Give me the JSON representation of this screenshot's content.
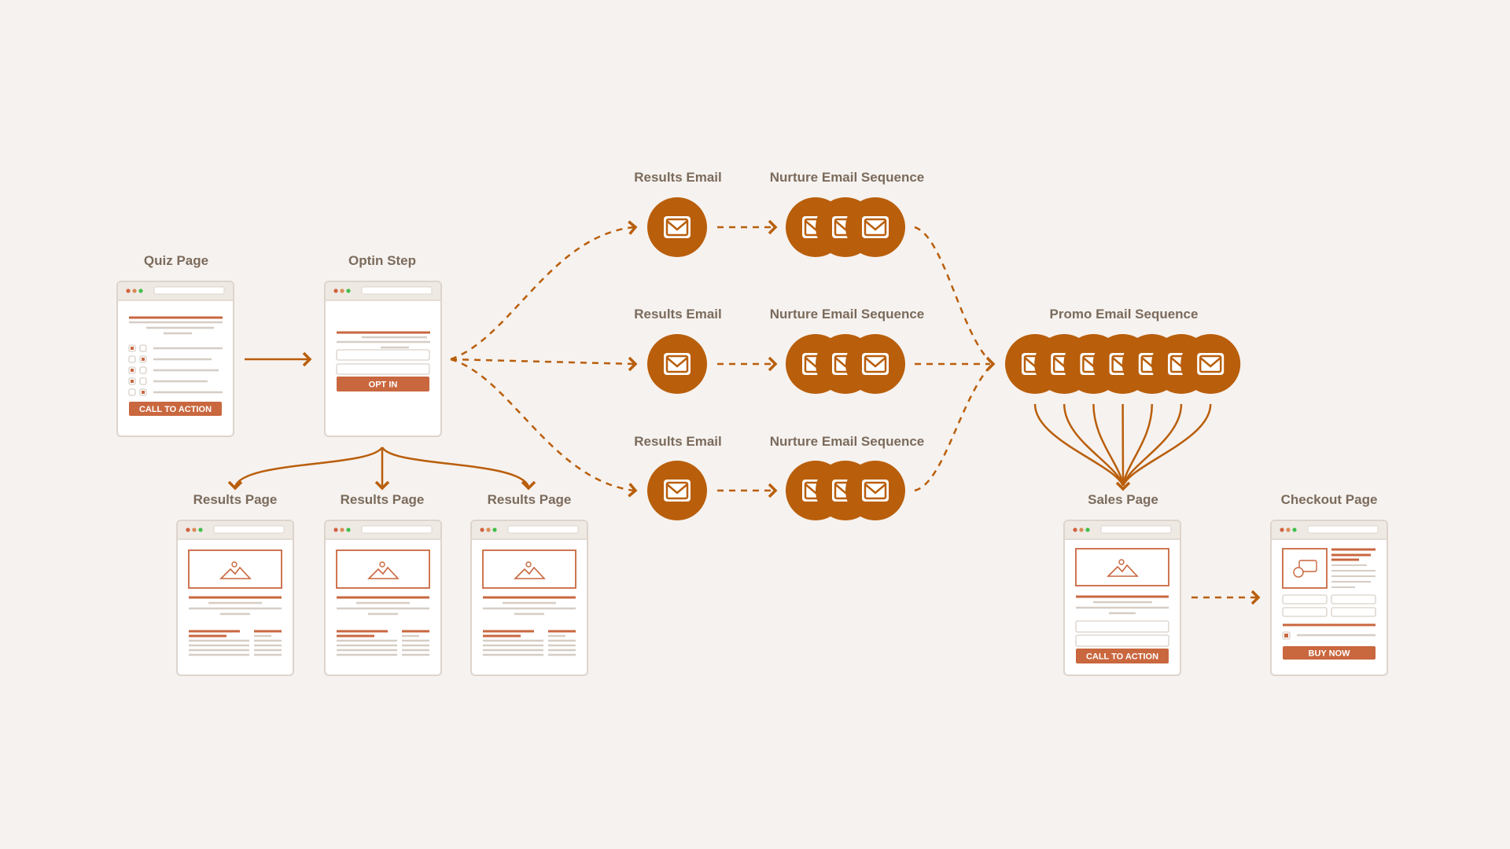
{
  "colors": {
    "background": "#f6f2ef",
    "accent": "#b95e0b",
    "page_accent": "#c9673f",
    "text": "#7b6b5c",
    "line": "#d6cdc5"
  },
  "nodes": {
    "quiz_page": {
      "label": "Quiz Page",
      "button": "CALL TO ACTION"
    },
    "optin_step": {
      "label": "Optin Step",
      "button": "OPT IN"
    },
    "results_pages": [
      {
        "label": "Results Page"
      },
      {
        "label": "Results Page"
      },
      {
        "label": "Results Page"
      }
    ],
    "results_emails": [
      {
        "label": "Results Email"
      },
      {
        "label": "Results Email"
      },
      {
        "label": "Results Email"
      }
    ],
    "nurture_sequences": [
      {
        "label": "Nurture Email Sequence"
      },
      {
        "label": "Nurture Email Sequence"
      },
      {
        "label": "Nurture Email Sequence"
      }
    ],
    "promo_sequence": {
      "label": "Promo Email Sequence"
    },
    "sales_page": {
      "label": "Sales Page",
      "button": "CALL TO ACTION"
    },
    "checkout_page": {
      "label": "Checkout Page",
      "button": "BUY NOW"
    }
  },
  "icons": {
    "email": "envelope-icon",
    "image": "image-placeholder-icon",
    "payment": "credit-card-dollar-icon"
  }
}
